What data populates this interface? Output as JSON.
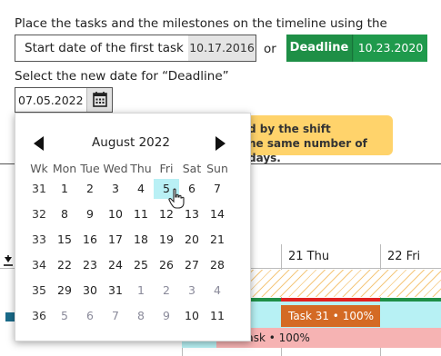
{
  "instruction": "Place the tasks and the milestones on the timeline using the",
  "start_field": {
    "label": "Start date of the first task",
    "value": "10.17.2016"
  },
  "or_text": "or",
  "deadline": {
    "label": "Deadline",
    "value": "10.23.2020"
  },
  "select_prompt": "Select the new date for “Deadline”",
  "date_input": {
    "value": "07.05.2022"
  },
  "hint": {
    "line1": "d by the shift",
    "line2": "ne same number of days."
  },
  "timeline": {
    "days": [
      "21 Thu",
      "22 Fri"
    ],
    "task31": "Task 31 • 100%",
    "task_bottom": "Task • 100%"
  },
  "colors": {
    "deadline_green": "#1e8f46",
    "selected_day": "#b9f0f5",
    "hint_yellow": "#ffd36b",
    "task_orange": "#d46a24"
  },
  "calendar": {
    "month_title": "August 2022",
    "headers": [
      "Wk",
      "Mon",
      "Tue",
      "Wed",
      "Thu",
      "Fri",
      "Sat",
      "Sun"
    ],
    "weeks": [
      {
        "wk": "31",
        "days": [
          "1",
          "2",
          "3",
          "4",
          "5",
          "6",
          "7"
        ]
      },
      {
        "wk": "32",
        "days": [
          "8",
          "9",
          "10",
          "11",
          "12",
          "13",
          "14"
        ]
      },
      {
        "wk": "33",
        "days": [
          "15",
          "16",
          "17",
          "18",
          "19",
          "20",
          "21"
        ]
      },
      {
        "wk": "34",
        "days": [
          "22",
          "23",
          "24",
          "25",
          "26",
          "27",
          "28"
        ]
      },
      {
        "wk": "35",
        "days": [
          "29",
          "30",
          "31",
          "1",
          "2",
          "3",
          "4"
        ]
      },
      {
        "wk": "36",
        "days": [
          "5",
          "6",
          "7",
          "8",
          "9",
          "10",
          "11"
        ]
      }
    ]
  }
}
